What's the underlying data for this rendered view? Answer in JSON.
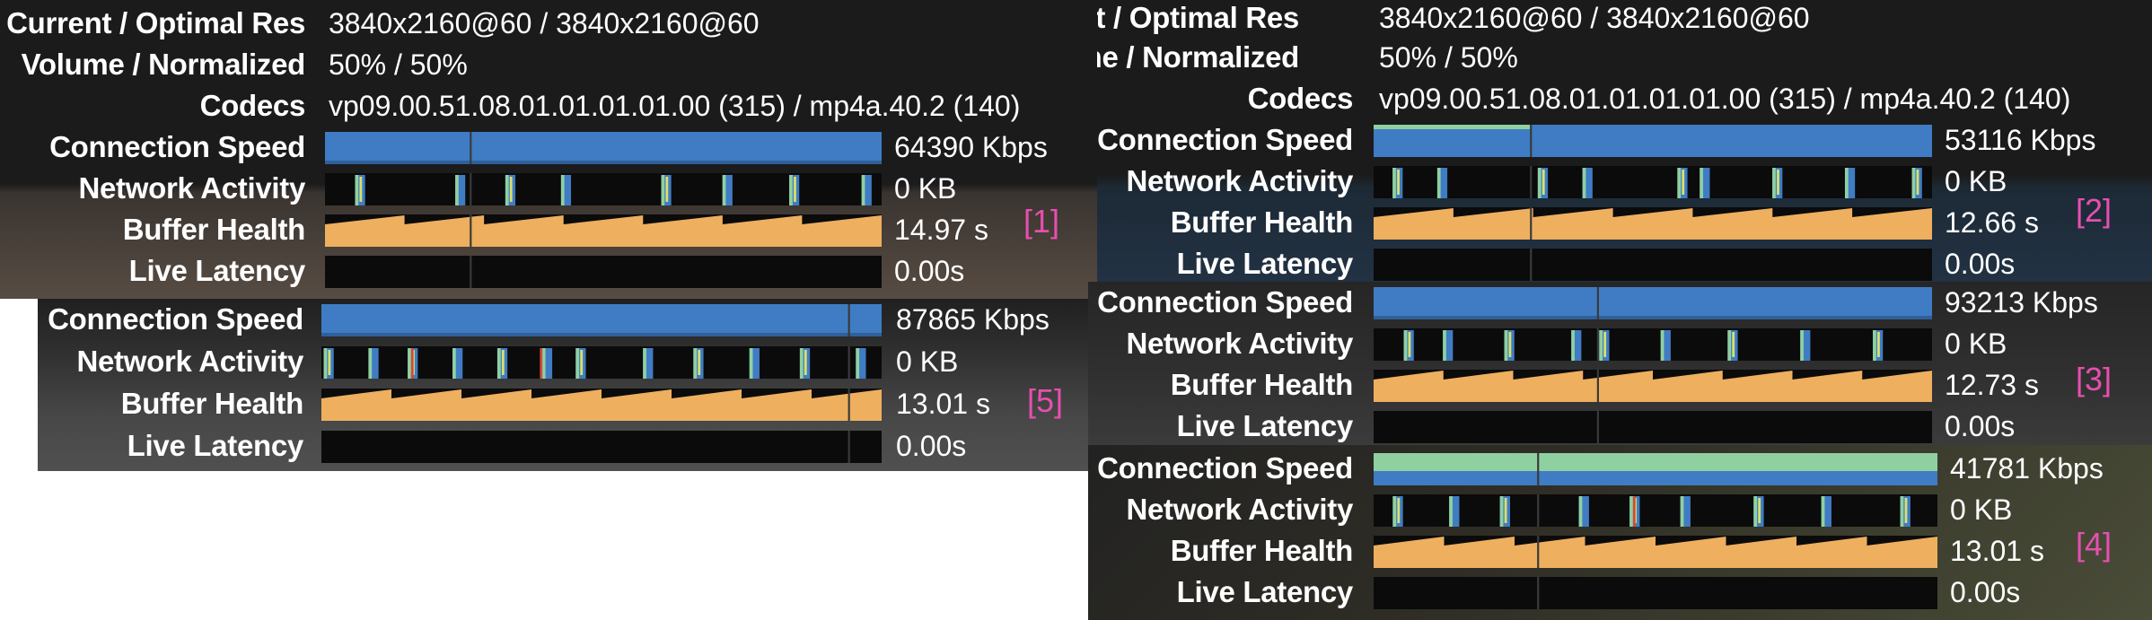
{
  "panels": [
    {
      "tag": "[1]",
      "current_optimal_res_label": "Current / Optimal Res",
      "current_optimal_res_value": "3840x2160@60 / 3840x2160@60",
      "volume_label": "Volume / Normalized",
      "volume_value": "50% / 50%",
      "codecs_label": "Codecs",
      "codecs_value": "vp09.00.51.08.01.01.01.01.00 (315) / mp4a.40.2 (140)",
      "connection_speed_label": "Connection Speed",
      "connection_speed_value": "64390 Kbps",
      "network_activity_label": "Network Activity",
      "network_activity_value": "0 KB",
      "buffer_health_label": "Buffer Health",
      "buffer_health_value": "14.97 s",
      "live_latency_label": "Live Latency",
      "live_latency_value": "0.00s"
    },
    {
      "tag": "[2]",
      "current_optimal_res_label": "rent / Optimal Res",
      "current_optimal_res_value": "3840x2160@60 / 3840x2160@60",
      "volume_label": "lume / Normalized",
      "volume_value": "50% / 50%",
      "codecs_label": "Codecs",
      "codecs_value": "vp09.00.51.08.01.01.01.01.00 (315) / mp4a.40.2 (140)",
      "connection_speed_label": "Connection Speed",
      "connection_speed_value": "53116 Kbps",
      "network_activity_label": "Network Activity",
      "network_activity_value": "0 KB",
      "buffer_health_label": "Buffer Health",
      "buffer_health_value": "12.66 s",
      "live_latency_label": "Live Latency",
      "live_latency_value": "0.00s"
    },
    {
      "tag": "[3]",
      "connection_speed_label": "Connection Speed",
      "connection_speed_value": "93213 Kbps",
      "network_activity_label": "Network Activity",
      "network_activity_value": "0 KB",
      "buffer_health_label": "Buffer Health",
      "buffer_health_value": "12.73 s",
      "live_latency_label": "Live Latency",
      "live_latency_value": "0.00s"
    },
    {
      "tag": "[4]",
      "connection_speed_label": "Connection Speed",
      "connection_speed_value": "41781 Kbps",
      "network_activity_label": "Network Activity",
      "network_activity_value": "0 KB",
      "buffer_health_label": "Buffer Health",
      "buffer_health_value": "13.01 s",
      "live_latency_label": "Live Latency",
      "live_latency_value": "0.00s"
    },
    {
      "tag": "[5]",
      "connection_speed_label": "Connection Speed",
      "connection_speed_value": "87865 Kbps",
      "network_activity_label": "Network Activity",
      "network_activity_value": "0 KB",
      "buffer_health_label": "Buffer Health",
      "buffer_health_value": "13.01 s",
      "live_latency_label": "Live Latency",
      "live_latency_value": "0.00s"
    }
  ],
  "colors": {
    "connection_blue": "#3f7cc4",
    "connection_green": "#8fd0a0",
    "buffer_orange": "#eeaf5f",
    "activity_blue": "#3f7cc4",
    "activity_green": "#8fd0a0",
    "activity_yellow": "#d9e06a",
    "activity_red": "#d24a3a",
    "tag_pink": "#e64fb0",
    "panel_dark": "#1b1b1b"
  }
}
